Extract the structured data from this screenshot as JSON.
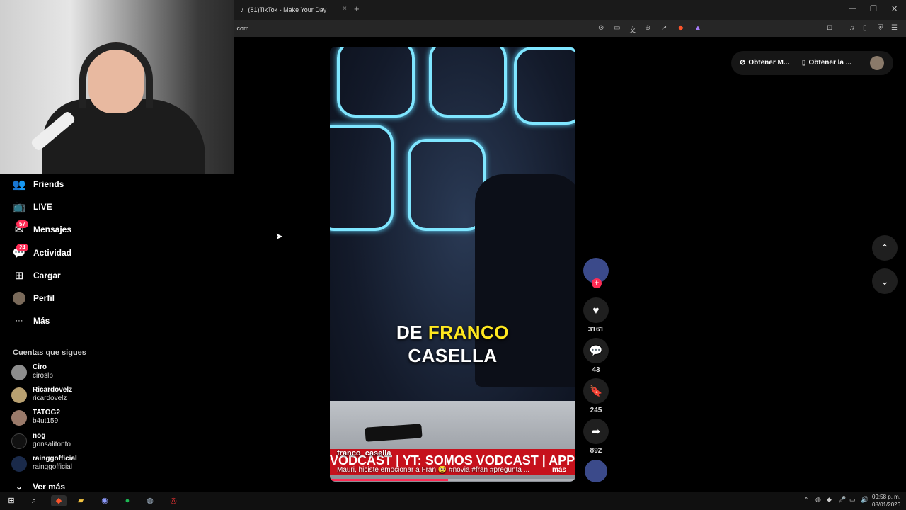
{
  "browser": {
    "tab_title": "(81)TikTok - Make Your Day",
    "url": ".com",
    "new_tab_label": "+"
  },
  "sidebar": {
    "items": [
      {
        "label": "Friends",
        "icon": "friends-icon",
        "glyph": "👥"
      },
      {
        "label": "LIVE",
        "icon": "live-icon",
        "glyph": "📺"
      },
      {
        "label": "Mensajes",
        "icon": "messages-icon",
        "glyph": "✉",
        "badge": "57"
      },
      {
        "label": "Actividad",
        "icon": "activity-icon",
        "glyph": "💬",
        "badge": "24"
      },
      {
        "label": "Cargar",
        "icon": "upload-icon",
        "glyph": "⊞"
      },
      {
        "label": "Perfil",
        "icon": "profile-icon",
        "glyph": ""
      },
      {
        "label": "Más",
        "icon": "more-icon",
        "glyph": "···"
      }
    ],
    "following_title": "Cuentas que sigues",
    "following": [
      {
        "name": "Ciro",
        "handle": "ciroslp"
      },
      {
        "name": "Ricardovelz",
        "handle": "ricardovelz"
      },
      {
        "name": "TATOG2",
        "handle": "b4ut159"
      },
      {
        "name": "nog",
        "handle": "gonsalitonto"
      },
      {
        "name": "rainggofficial",
        "handle": "rainggofficial"
      }
    ],
    "see_more": "Ver más"
  },
  "video": {
    "caption_line1_a": "DE ",
    "caption_line1_b": "FRANCO",
    "caption_line2": "CASELLA",
    "ticker": "VODCAST | YT: SOMOS VODCAST | APP: SOMOS",
    "author": "franco_casella",
    "description": "Mauri, hiciste emocionar a Fran 🥹 #novia #fran #pregunta ...",
    "more_label": "más",
    "progress": 0.48,
    "highlight_color": "#ffe81f",
    "ticker_color": "#c6111c"
  },
  "actions": {
    "likes": "3161",
    "comments": "43",
    "saves": "245",
    "shares": "892"
  },
  "top_right": {
    "pill1": "Obtener M...",
    "pill2": "Obtener la ..."
  },
  "taskbar": {
    "time": "09:58 p. m.",
    "date": "08/01/2026"
  },
  "colors": {
    "accent": "#fe2c55",
    "background": "#000000"
  }
}
